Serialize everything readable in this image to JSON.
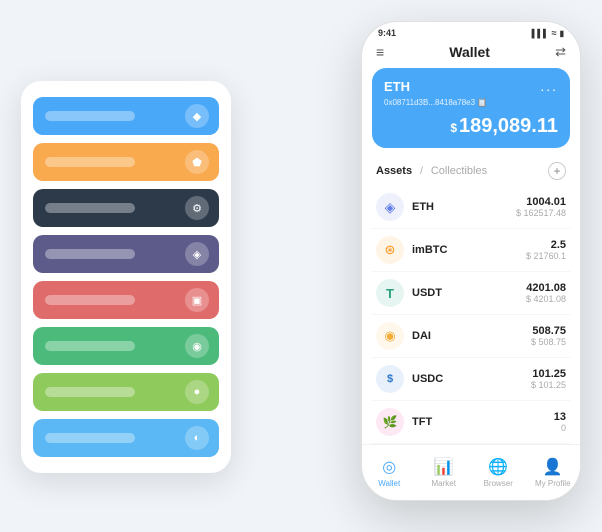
{
  "scene": {
    "background": "#f0f4f8"
  },
  "cardStack": {
    "cards": [
      {
        "id": "blue",
        "colorClass": "card-blue",
        "icon": "◆"
      },
      {
        "id": "orange",
        "colorClass": "card-orange",
        "icon": "⬟"
      },
      {
        "id": "dark",
        "colorClass": "card-dark",
        "icon": "⚙"
      },
      {
        "id": "purple",
        "colorClass": "card-purple",
        "icon": "◈"
      },
      {
        "id": "red",
        "colorClass": "card-red",
        "icon": "▣"
      },
      {
        "id": "green",
        "colorClass": "card-green",
        "icon": "◉"
      },
      {
        "id": "light-green",
        "colorClass": "card-light-green",
        "icon": "●"
      },
      {
        "id": "light-blue",
        "colorClass": "card-light-blue",
        "icon": "◐"
      }
    ]
  },
  "phone": {
    "statusBar": {
      "time": "9:41",
      "signal": "▌▌▌",
      "wifi": "WiFi",
      "battery": "🔋"
    },
    "header": {
      "menuIcon": "≡",
      "title": "Wallet",
      "scanIcon": "⇄"
    },
    "ethCard": {
      "name": "ETH",
      "dots": "...",
      "address": "0x08711d3B...8418a78e3  📋",
      "currencySymbol": "$",
      "amount": "189,089.11"
    },
    "assetsTabs": {
      "active": "Assets",
      "separator": "/",
      "inactive": "Collectibles"
    },
    "addButtonLabel": "+",
    "assets": [
      {
        "id": "eth",
        "icon": "◈",
        "iconColor": "#627eea",
        "iconBg": "#eef0fc",
        "name": "ETH",
        "amount": "1004.01",
        "usd": "$ 162517.48"
      },
      {
        "id": "imbtc",
        "icon": "⊛",
        "iconColor": "#f7931a",
        "iconBg": "#fff5e6",
        "name": "imBTC",
        "amount": "2.5",
        "usd": "$ 21760.1"
      },
      {
        "id": "usdt",
        "icon": "T",
        "iconColor": "#26a17b",
        "iconBg": "#e6f5f1",
        "name": "USDT",
        "amount": "4201.08",
        "usd": "$ 4201.08"
      },
      {
        "id": "dai",
        "icon": "◉",
        "iconColor": "#f5ac37",
        "iconBg": "#fef8ec",
        "name": "DAI",
        "amount": "508.75",
        "usd": "$ 508.75"
      },
      {
        "id": "usdc",
        "icon": "$",
        "iconColor": "#2775ca",
        "iconBg": "#e8f1fb",
        "name": "USDC",
        "amount": "101.25",
        "usd": "$ 101.25"
      },
      {
        "id": "tft",
        "icon": "🌿",
        "iconColor": "#e84393",
        "iconBg": "#fde8f3",
        "name": "TFT",
        "amount": "13",
        "usd": "0"
      }
    ],
    "bottomNav": [
      {
        "id": "wallet",
        "icon": "◎",
        "label": "Wallet",
        "active": true
      },
      {
        "id": "market",
        "icon": "📊",
        "label": "Market",
        "active": false
      },
      {
        "id": "browser",
        "icon": "🌐",
        "label": "Browser",
        "active": false
      },
      {
        "id": "profile",
        "icon": "👤",
        "label": "My Profile",
        "active": false
      }
    ]
  }
}
